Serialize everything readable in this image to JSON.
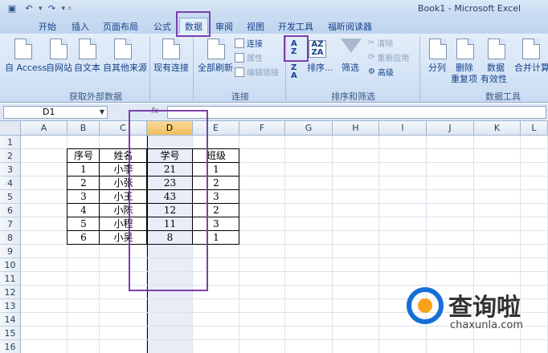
{
  "window": {
    "title": "Book1 - Microsoft Excel"
  },
  "qat": {
    "save_icon": "save-icon",
    "undo_icon": "undo-icon",
    "redo_icon": "redo-icon"
  },
  "tabs": [
    {
      "label": "开始"
    },
    {
      "label": "插入"
    },
    {
      "label": "页面布局"
    },
    {
      "label": "公式"
    },
    {
      "label": "数据"
    },
    {
      "label": "审阅"
    },
    {
      "label": "视图"
    },
    {
      "label": "开发工具"
    },
    {
      "label": "福昕阅读器"
    }
  ],
  "ribbon": {
    "external": {
      "label": "获取外部数据",
      "access": "自 Access",
      "web": "自网站",
      "text": "自文本",
      "other": "自其他来源",
      "existing": "现有连接"
    },
    "connections": {
      "label": "连接",
      "refresh_all": "全部刷新",
      "connections": "连接",
      "properties": "属性",
      "edit_links": "编辑链接"
    },
    "sort_filter": {
      "label": "排序和筛选",
      "sort": "排序...",
      "filter": "筛选",
      "clear": "清除",
      "reapply": "重新应用",
      "advanced": "高级"
    },
    "data_tools": {
      "label": "数据工具",
      "text_to_columns": "分列",
      "remove_dup_1": "删除",
      "remove_dup_2": "重复项",
      "validation_1": "数据",
      "validation_2": "有效性",
      "consolidate": "合并计算"
    }
  },
  "formula_bar": {
    "name_box": "D1",
    "fx": "fx",
    "value": ""
  },
  "grid": {
    "columns": [
      "A",
      "B",
      "C",
      "D",
      "E",
      "F",
      "G",
      "H",
      "I",
      "J",
      "K",
      "L"
    ],
    "rows": [
      "1",
      "2",
      "3",
      "4",
      "5",
      "6",
      "7",
      "8",
      "9",
      "10",
      "11",
      "12",
      "13",
      "14",
      "15",
      "16"
    ],
    "selected_column": "D"
  },
  "table": {
    "headers": [
      "序号",
      "姓名",
      "学号",
      "班级"
    ],
    "rows": [
      [
        "1",
        "小李",
        "21",
        "1"
      ],
      [
        "2",
        "小张",
        "23",
        "2"
      ],
      [
        "3",
        "小王",
        "43",
        "3"
      ],
      [
        "4",
        "小陈",
        "12",
        "2"
      ],
      [
        "5",
        "小程",
        "11",
        "3"
      ],
      [
        "6",
        "小吴",
        "8",
        "1"
      ]
    ]
  },
  "watermark": {
    "text": "查询啦",
    "url": "chaxunla.com"
  },
  "colors": {
    "annotation": "#7b3fae",
    "selection": "#e8edf7",
    "ribbon": "#d5e4f6"
  }
}
